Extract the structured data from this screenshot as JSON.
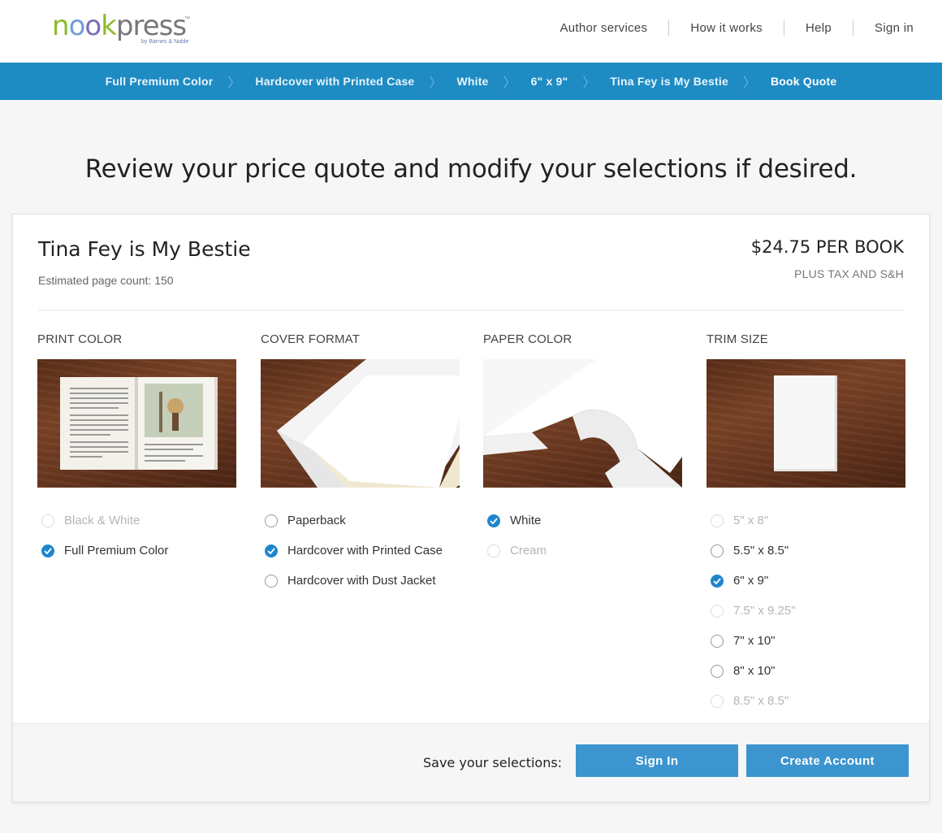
{
  "brand": {
    "logo_n": "n",
    "logo_o1": "o",
    "logo_o2": "o",
    "logo_k": "k",
    "logo_press": "press",
    "logo_tm": "™",
    "logo_by": "by Barnes & Noble"
  },
  "topnav": {
    "items": [
      {
        "label": "Author services"
      },
      {
        "label": "How it works"
      },
      {
        "label": "Help"
      },
      {
        "label": "Sign in"
      }
    ]
  },
  "breadcrumb": {
    "items": [
      {
        "label": "Full Premium Color"
      },
      {
        "label": "Hardcover with Printed Case"
      },
      {
        "label": "White"
      },
      {
        "label": "6\" x 9\""
      },
      {
        "label": "Tina Fey is My Bestie"
      },
      {
        "label": "Book Quote"
      }
    ],
    "separator": "〉"
  },
  "headline": "Review your price quote and modify your selections if desired.",
  "book": {
    "title": "Tina Fey is My Bestie",
    "page_count": "Estimated page count: 150",
    "price": "$24.75 PER BOOK",
    "price_note": "PLUS TAX AND S&H"
  },
  "columns": {
    "print_color": {
      "heading": "PRINT COLOR",
      "options": [
        {
          "label": "Black & White",
          "selected": false,
          "disabled": true
        },
        {
          "label": "Full Premium Color",
          "selected": true,
          "disabled": false
        }
      ]
    },
    "cover_format": {
      "heading": "COVER FORMAT",
      "options": [
        {
          "label": "Paperback",
          "selected": false,
          "disabled": false
        },
        {
          "label": "Hardcover with Printed Case",
          "selected": true,
          "disabled": false
        },
        {
          "label": "Hardcover with Dust Jacket",
          "selected": false,
          "disabled": false
        }
      ]
    },
    "paper_color": {
      "heading": "PAPER COLOR",
      "options": [
        {
          "label": "White",
          "selected": true,
          "disabled": false
        },
        {
          "label": "Cream",
          "selected": false,
          "disabled": true
        }
      ]
    },
    "trim_size": {
      "heading": "TRIM SIZE",
      "options": [
        {
          "label": "5\" x 8\"",
          "selected": false,
          "disabled": true
        },
        {
          "label": "5.5\" x 8.5\"",
          "selected": false,
          "disabled": false
        },
        {
          "label": "6\" x 9\"",
          "selected": true,
          "disabled": false
        },
        {
          "label": "7.5\" x 9.25\"",
          "selected": false,
          "disabled": true
        },
        {
          "label": "7\" x 10\"",
          "selected": false,
          "disabled": false
        },
        {
          "label": "8\" x 10\"",
          "selected": false,
          "disabled": false
        },
        {
          "label": "8.5\" x 8.5\"",
          "selected": false,
          "disabled": true
        }
      ]
    }
  },
  "footer": {
    "save_label": "Save your selections:",
    "signin_button": "Sign In",
    "create_button": "Create Account"
  },
  "colors": {
    "accent": "#1e8bc3",
    "button": "#3c95cf",
    "checked": "#1f86cc"
  }
}
